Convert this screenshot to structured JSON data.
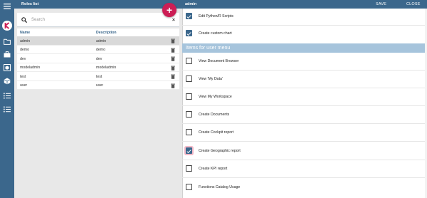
{
  "rail": {
    "icons": [
      "menu-icon",
      "brand-logo-icon",
      "folder-icon",
      "briefcase-icon",
      "cube-window-icon",
      "cube-icon",
      "list-icon",
      "list-alt-icon"
    ],
    "colors": {
      "background": "#3b678c",
      "logo": "#cc1e55"
    }
  },
  "roles_panel": {
    "title": "Roles list",
    "search_placeholder": "Search",
    "clear_icon": "close-icon",
    "columns": {
      "name": "Name",
      "description": "Description"
    },
    "rows": [
      {
        "name": "admin",
        "description": "admin",
        "selected": true
      },
      {
        "name": "demo",
        "description": "demo",
        "selected": false
      },
      {
        "name": "dev",
        "description": "dev",
        "selected": false
      },
      {
        "name": "modeladmin",
        "description": "modeladmin",
        "selected": false
      },
      {
        "name": "test",
        "description": "test",
        "selected": false
      },
      {
        "name": "user",
        "description": "user",
        "selected": false
      }
    ],
    "add_button_label": "+"
  },
  "detail": {
    "title": "admin",
    "save_label": "SAVE",
    "close_label": "CLOSE",
    "items_top": [
      {
        "label": "Edit Python/R Scripts",
        "checked": true
      },
      {
        "label": "Create custom chart",
        "checked": true
      }
    ],
    "section_title": "Items for user menu",
    "items_menu": [
      {
        "label": "View Document Browser",
        "checked": false
      },
      {
        "label": "View 'My Data'",
        "checked": false
      },
      {
        "label": "View My Workspace",
        "checked": false
      },
      {
        "label": "Create Documents",
        "checked": false
      },
      {
        "label": "Create Cockpit report",
        "checked": false
      },
      {
        "label": "Create Geographic report",
        "checked": true
      },
      {
        "label": "Create KPI report",
        "checked": false
      },
      {
        "label": "Functions Catalog Usage",
        "checked": false
      }
    ]
  }
}
